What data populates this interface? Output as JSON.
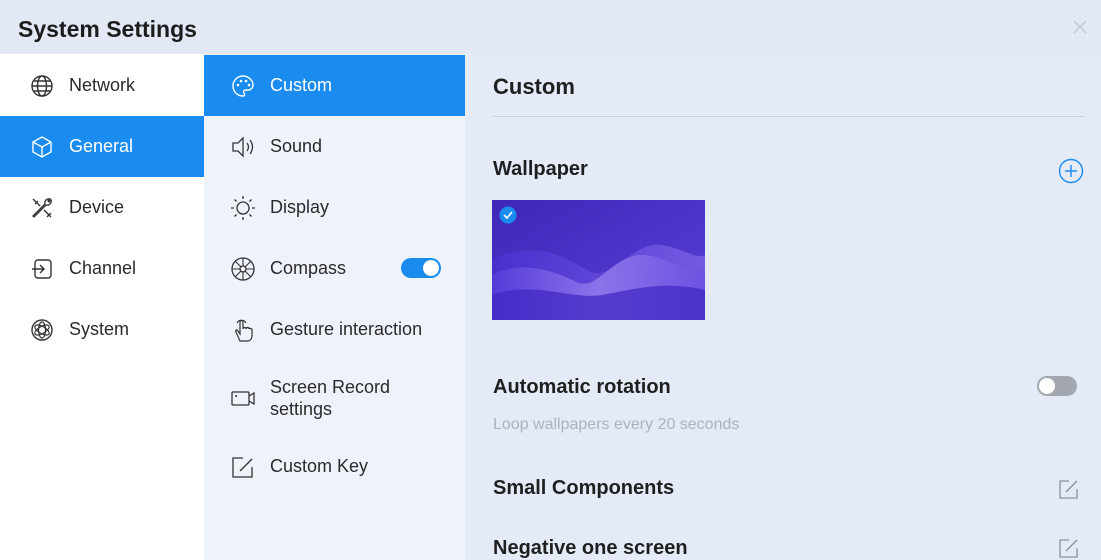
{
  "window": {
    "title": "System Settings"
  },
  "nav": {
    "items": [
      {
        "label": "Network",
        "icon": "globe-icon",
        "active": false
      },
      {
        "label": "General",
        "icon": "cube-icon",
        "active": true
      },
      {
        "label": "Device",
        "icon": "tools-icon",
        "active": false
      },
      {
        "label": "Channel",
        "icon": "input-icon",
        "active": false
      },
      {
        "label": "System",
        "icon": "atom-icon",
        "active": false
      }
    ]
  },
  "sub": {
    "items": [
      {
        "label": "Custom",
        "icon": "palette-icon",
        "active": true
      },
      {
        "label": "Sound",
        "icon": "speaker-icon",
        "active": false
      },
      {
        "label": "Display",
        "icon": "sun-icon",
        "active": false
      },
      {
        "label": "Compass",
        "icon": "compass-icon",
        "active": false,
        "toggle": true
      },
      {
        "label": "Gesture interaction",
        "icon": "hand-pointer-icon",
        "active": false
      },
      {
        "label_line1": "Screen Record",
        "label_line2": "settings",
        "icon": "camera-icon",
        "active": false
      },
      {
        "label": "Custom Key",
        "icon": "edit-icon",
        "active": false
      }
    ]
  },
  "content": {
    "header": "Custom",
    "wallpaper": {
      "title": "Wallpaper",
      "selected": true
    },
    "auto_rotation": {
      "title": "Automatic rotation",
      "enabled": false,
      "hint": "Loop wallpapers every 20 seconds"
    },
    "small_components": {
      "title": "Small Components"
    },
    "negative_one": {
      "title": "Negative one screen"
    }
  },
  "colors": {
    "accent": "#1a8cf0",
    "toggle_off": "#a3a8b0"
  }
}
